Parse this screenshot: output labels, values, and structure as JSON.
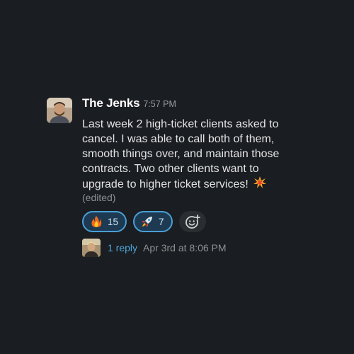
{
  "message": {
    "author": "The Jenks",
    "timestamp": "7:57 PM",
    "text": "Last week 2 high-ticket clients asked to cancel. I was able to call both of them, smooth things over, and maintain those contracts. Two other clients want to upgrade to higher ticket services!",
    "trailing_emoji": "collision-icon",
    "edited_label": "(edited)"
  },
  "reactions": [
    {
      "emoji": "fire-icon",
      "count": "15"
    },
    {
      "emoji": "rocket-icon",
      "count": "7"
    }
  ],
  "add_reaction_icon": "add-reaction-icon",
  "thread": {
    "reply_count": "1 reply",
    "last_reply": "Apr 3rd at 8:06 PM"
  },
  "colors": {
    "background": "#1a1d21",
    "reaction_border": "#4a9fd6",
    "reaction_bg": "#1d3a52",
    "link": "#4ea5d9"
  }
}
